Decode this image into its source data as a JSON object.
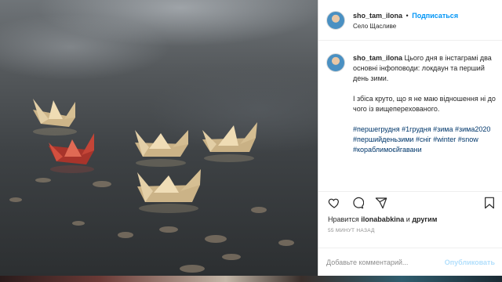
{
  "post": {
    "username": "sho_tam_ilona",
    "separator": "•",
    "follow_label": "Подписаться",
    "location": "Село Щасливе"
  },
  "caption": {
    "username": "sho_tam_ilona",
    "text1": "Цього дня в інстаграмі два основні інфоповоди: локдаун та перший день зими.",
    "text2": "І збіса круто, що я не маю відношення ні до чого із вищеперехованого.",
    "hashtags": [
      "#першегрудня",
      "#1грудня",
      "#зима",
      "#зима2020",
      "#першийденьзими",
      "#сніг",
      "#winter",
      "#snow",
      "#кораблимоєйгавани"
    ]
  },
  "likes": {
    "prefix": "Нравится",
    "user": "ilonababkina",
    "conj": "и",
    "others": "другим"
  },
  "timestamp": "55 МИНУТ НАЗАД",
  "comment_box": {
    "placeholder": "Добавьте комментарий...",
    "publish_label": "Опубликовать"
  },
  "icons": [
    "heart-icon",
    "comment-icon",
    "share-icon",
    "bookmark-icon"
  ],
  "colors": {
    "link_blue": "#0095f6",
    "hashtag": "#00376b",
    "boat_paper": "#d9c39a",
    "boat_red": "#c8453a"
  }
}
